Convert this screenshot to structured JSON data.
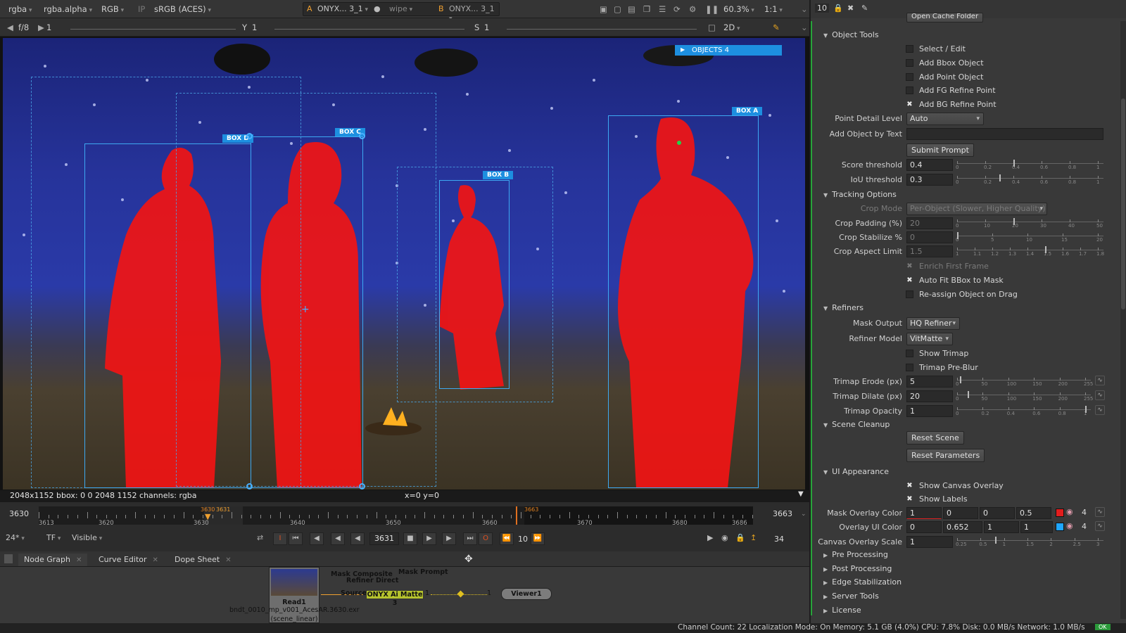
{
  "topbar": {
    "channels": "rgba",
    "alpha": "rgba.alpha",
    "rgb": "RGB",
    "ip": "IP",
    "colorspace": "sRGB (ACES)",
    "input_a_tag": "A",
    "input_a": "ONYX... 3_1",
    "wipe": "wipe",
    "input_b_tag": "B",
    "input_b": "ONYX... 3_1",
    "zoom": "60.3%",
    "ratio": "1:1"
  },
  "row2": {
    "fstop": "f/8",
    "fstop_value": "1",
    "y_label": "Y",
    "y_value": "1",
    "s_label": "S",
    "s_value": "1",
    "view_mode": "2D"
  },
  "viewer": {
    "objects_label": "OBJECTS 4",
    "boxes": [
      {
        "label": "BOX A"
      },
      {
        "label": "BOX B"
      },
      {
        "label": "BOX C"
      },
      {
        "label": "BOX D"
      }
    ],
    "status_left": "2048x1152  bbox: 0 0 2048 1152 channels: rgba",
    "status_center": "x=0 y=0"
  },
  "timeline": {
    "start_frame": "3630",
    "end_frame": "3663",
    "in_marker": "3630",
    "current_marker": "3631",
    "out_marker": "3663",
    "tick_labels": [
      "3613",
      "3620",
      "3630",
      "3640",
      "3650",
      "3660",
      "3670",
      "3680",
      "3686"
    ],
    "fps": "24*",
    "tf": "TF",
    "visibility": "Visible",
    "current_frame": "3631",
    "step": "10",
    "last_field": "34",
    "in_btn": "I",
    "out_btn": "O"
  },
  "node_tabs": {
    "node_graph": "Node Graph",
    "curve_editor": "Curve Editor",
    "dope_sheet": "Dope Sheet"
  },
  "nodes": {
    "read_name": "Read1",
    "read_file": "bndt_0010_mp_v001_AcesAR.3630.exr",
    "read_colorspace": "(scene_linear)",
    "mask_composite": "Mask Composite",
    "refiner_direct": "Refiner Direct",
    "mask_prompt": "Mask Prompt",
    "source": "Source",
    "onyx": "ONYX Ai Matte 3",
    "onyx_suffix": "1",
    "viewer_input": "1",
    "viewer": "Viewer1"
  },
  "status_bar": "Channel Count: 22  Localization Mode: On  Memory: 5.1 GB (4.0%)  CPU: 7.8%  Disk: 0.0 MB/s  Network: 1.0 MB/s",
  "status_ok": "OK",
  "panel": {
    "count": "10",
    "cache_button": "Open Cache Folder",
    "object_tools": {
      "title": "Object Tools",
      "items": [
        {
          "label": "Select / Edit",
          "checked": ""
        },
        {
          "label": "Add Bbox Object",
          "checked": ""
        },
        {
          "label": "Add Point Object",
          "checked": ""
        },
        {
          "label": "Add FG Refine Point",
          "checked": ""
        },
        {
          "label": "Add BG Refine Point",
          "checked": "✖"
        }
      ],
      "point_detail_label": "Point Detail Level",
      "point_detail_value": "Auto",
      "add_by_text_label": "Add Object by Text",
      "add_by_text_value": "",
      "submit": "Submit Prompt",
      "score_label": "Score threshold",
      "score_value": "0.4",
      "score_ticks": [
        "0",
        "0.2",
        "0.4",
        "0.6",
        "0.8",
        "1"
      ],
      "iou_label": "IoU threshold",
      "iou_value": "0.3",
      "iou_ticks": [
        "0",
        "0.2",
        "0.4",
        "0.6",
        "0.8",
        "1"
      ]
    },
    "tracking": {
      "title": "Tracking Options",
      "crop_mode_label": "Crop Mode",
      "crop_mode_value": "Per-Object (Slower, Higher Quality)",
      "crop_padding_label": "Crop Padding (%)",
      "crop_padding_value": "20",
      "crop_padding_ticks": [
        "0",
        "10",
        "20",
        "30",
        "40",
        "50"
      ],
      "crop_stabilize_label": "Crop Stabilize %",
      "crop_stabilize_value": "0",
      "crop_stabilize_ticks": [
        "0",
        "5",
        "10",
        "15",
        "20"
      ],
      "crop_aspect_label": "Crop Aspect Limit",
      "crop_aspect_value": "1.5",
      "crop_aspect_ticks": [
        "1",
        "1.1",
        "1.2",
        "1.3",
        "1.4",
        "1.5",
        "1.6",
        "1.7",
        "1.8"
      ],
      "enrich_label": "Enrich First Frame",
      "enrich_checked": "✖",
      "autofit_label": "Auto Fit BBox to Mask",
      "autofit_checked": "✖",
      "reassign_label": "Re-assign Object on Drag",
      "reassign_checked": ""
    },
    "refiners": {
      "title": "Refiners",
      "mask_output_label": "Mask Output",
      "mask_output_value": "HQ Refiner",
      "refiner_model_label": "Refiner Model",
      "refiner_model_value": "VitMatte",
      "show_trimap": "Show Trimap",
      "trimap_preblur": "Trimap Pre-Blur",
      "erode_label": "Trimap Erode (px)",
      "erode_value": "5",
      "erode_ticks": [
        "0",
        "50",
        "100",
        "150",
        "200",
        "255"
      ],
      "dilate_label": "Trimap Dilate (px)",
      "dilate_value": "20",
      "dilate_ticks": [
        "0",
        "50",
        "100",
        "150",
        "200",
        "255"
      ],
      "opacity_label": "Trimap Opacity",
      "opacity_value": "1",
      "opacity_ticks": [
        "0",
        "0.2",
        "0.4",
        "0.6",
        "0.8",
        "1"
      ]
    },
    "scene_cleanup": {
      "title": "Scene Cleanup",
      "reset_scene": "Reset Scene",
      "reset_params": "Reset Parameters"
    },
    "ui_appearance": {
      "title": "UI Appearance",
      "show_canvas_overlay": "Show Canvas Overlay",
      "show_canvas_overlay_checked": "✖",
      "show_labels": "Show Labels",
      "show_labels_checked": "✖",
      "mask_color_label": "Mask Overlay Color",
      "mask_color_values": [
        "1",
        "0",
        "0",
        "0.5"
      ],
      "mask_color_swatch": "#e21d1d",
      "mask_color_count": "4",
      "overlay_color_label": "Overlay UI Color",
      "overlay_color_values": [
        "0",
        "0.652",
        "1",
        "1"
      ],
      "overlay_color_swatch": "#1fa6ff",
      "overlay_color_count": "4",
      "scale_label": "Canvas Overlay Scale",
      "scale_value": "1",
      "scale_ticks": [
        "0.25",
        "0.5",
        "1",
        "1.5",
        "2",
        "2.5",
        "3"
      ]
    },
    "collapsed_sections": [
      "Pre Processing",
      "Post Processing",
      "Edge Stabilization",
      "Server Tools",
      "License"
    ]
  }
}
